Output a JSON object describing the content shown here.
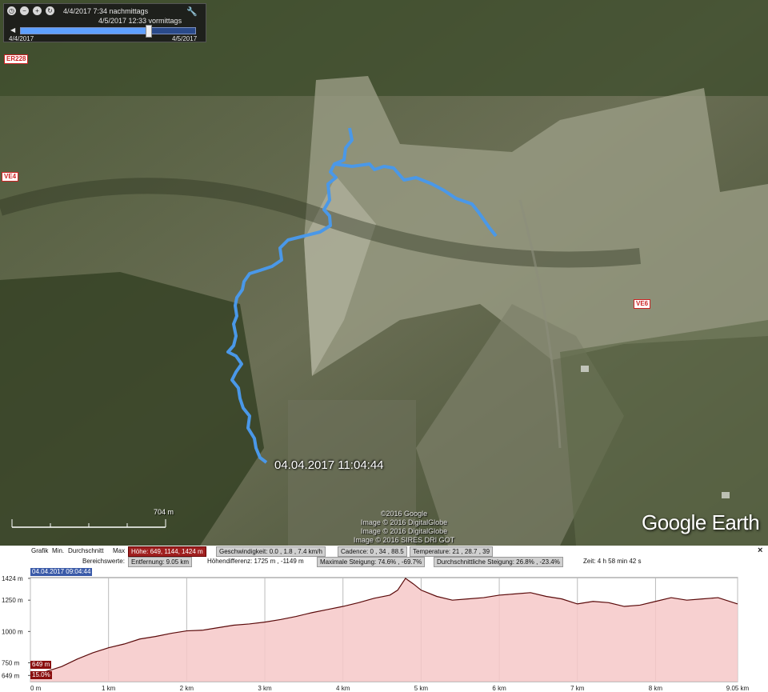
{
  "time_slider": {
    "date_time_line1": "4/4/2017   7:34 nachmittags",
    "date_time_line2": "4/5/2017  12:33 vormittags",
    "start_label": "4/4/2017",
    "end_label": "4/5/2017",
    "position_fraction": 0.73
  },
  "map": {
    "road_labels": [
      "ER228",
      "VE4",
      "VE6"
    ],
    "track_timestamp": "04.04.2017 11:04:44",
    "scale_label": "704  m",
    "copyright": [
      "©2016 Google",
      "Image © 2016 DigitalGlobe",
      "Image © 2016 DigitalGlobe",
      "Image © 2016 SIRES DRI GOT"
    ],
    "logo": "Google Earth",
    "track_color": "#4a98e8"
  },
  "profile": {
    "grafik_label": "Grafik",
    "min_label": "Min.",
    "avg_label": "Durchschnitt",
    "max_label": "Max",
    "hoehe": "Höhe: 649, 1144, 1424 m",
    "geschwindigkeit": "Geschwindigkeit: 0.0 , 1.8 , 7.4 km/h",
    "cadence": "Cadence: 0 , 34 , 88.5",
    "temperatur": "Temperature: 21 , 28.7 , 39",
    "bereichswerte_label": "Bereichswerte:",
    "entfernung": "Entfernung: 9.05 km",
    "hoehendifferenz": "Höhendifferenz: 1725 m , -1149 m",
    "max_steigung": "Maximale Steigung: 74.6% , -69.7%",
    "durch_steigung": "Durchschnittliche Steigung: 26.8% , -23.4%",
    "zeit": "Zeit: 4 h 58 min 42 s",
    "close": "×",
    "timestamp_badge": "04.04.2017 09:04:44",
    "hover_elevation": "649 m",
    "hover_grade": "15.0%",
    "accent_color": "#8a0f0f"
  },
  "chart_data": {
    "type": "area",
    "x_unit": "km",
    "y_ticks": [
      "1424 m",
      "1250 m",
      "1000 m",
      "750 m",
      "649 m"
    ],
    "y_tick_values": [
      1424,
      1250,
      1000,
      750,
      649
    ],
    "x_ticks": [
      "0 m",
      "1 km",
      "2 km",
      "3 km",
      "4 km",
      "5 km",
      "6 km",
      "7 km",
      "8 km",
      "9.05 km"
    ],
    "x_tick_values": [
      0,
      1,
      2,
      3,
      4,
      5,
      6,
      7,
      8,
      9.05
    ],
    "xlim": [
      0,
      9.05
    ],
    "ylim": [
      600,
      1430
    ],
    "x": [
      0,
      0.2,
      0.4,
      0.6,
      0.8,
      1.0,
      1.2,
      1.4,
      1.6,
      1.8,
      2.0,
      2.2,
      2.4,
      2.6,
      2.8,
      3.0,
      3.2,
      3.4,
      3.6,
      3.8,
      4.0,
      4.2,
      4.4,
      4.6,
      4.7,
      4.8,
      4.9,
      5.0,
      5.2,
      5.4,
      5.6,
      5.8,
      6.0,
      6.2,
      6.4,
      6.6,
      6.8,
      7.0,
      7.2,
      7.4,
      7.6,
      7.8,
      8.0,
      8.2,
      8.4,
      8.6,
      8.8,
      9.05
    ],
    "y": [
      649,
      680,
      720,
      780,
      830,
      870,
      900,
      940,
      960,
      985,
      1005,
      1010,
      1030,
      1050,
      1060,
      1075,
      1095,
      1120,
      1150,
      1175,
      1200,
      1230,
      1265,
      1290,
      1330,
      1424,
      1380,
      1330,
      1280,
      1250,
      1260,
      1270,
      1290,
      1300,
      1310,
      1280,
      1260,
      1220,
      1240,
      1230,
      1200,
      1210,
      1240,
      1270,
      1250,
      1260,
      1270,
      1220
    ],
    "line_color": "#5a0a0a",
    "fill_color": "#f6c8c8",
    "grid": true
  }
}
